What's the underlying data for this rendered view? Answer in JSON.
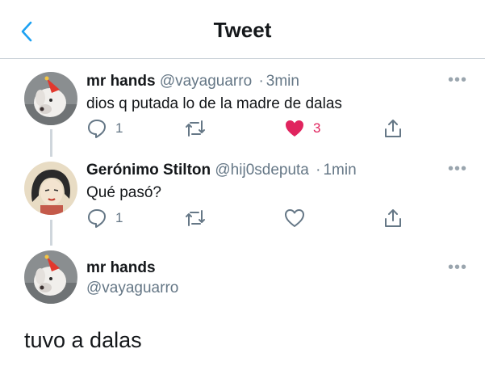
{
  "header": {
    "title": "Tweet"
  },
  "tweets": [
    {
      "name": "mr hands",
      "handle": "@vayaguarro",
      "separator": "·",
      "time": "3min",
      "text": "dios q putada lo de la madre de dalas",
      "reply_count": "1",
      "like_count": "3",
      "liked": true,
      "avatar_icon": "dog-with-party-hat-avatar"
    },
    {
      "name": "Gerónimo Stilton",
      "handle": "@hij0sdeputa",
      "separator": "·",
      "time": "1min",
      "text": "Qué pasó?",
      "reply_count": "1",
      "liked": false,
      "avatar_icon": "comic-woman-avatar"
    }
  ],
  "main_tweet": {
    "name": "mr hands",
    "handle": "@vayaguarro",
    "text": "tuvo a dalas",
    "avatar_icon": "dog-with-party-hat-avatar"
  },
  "icons": {
    "more": "•••"
  },
  "colors": {
    "accent": "#1da1f2",
    "like": "#e0245e",
    "secondary_text": "#657786",
    "icon": "#657786"
  }
}
